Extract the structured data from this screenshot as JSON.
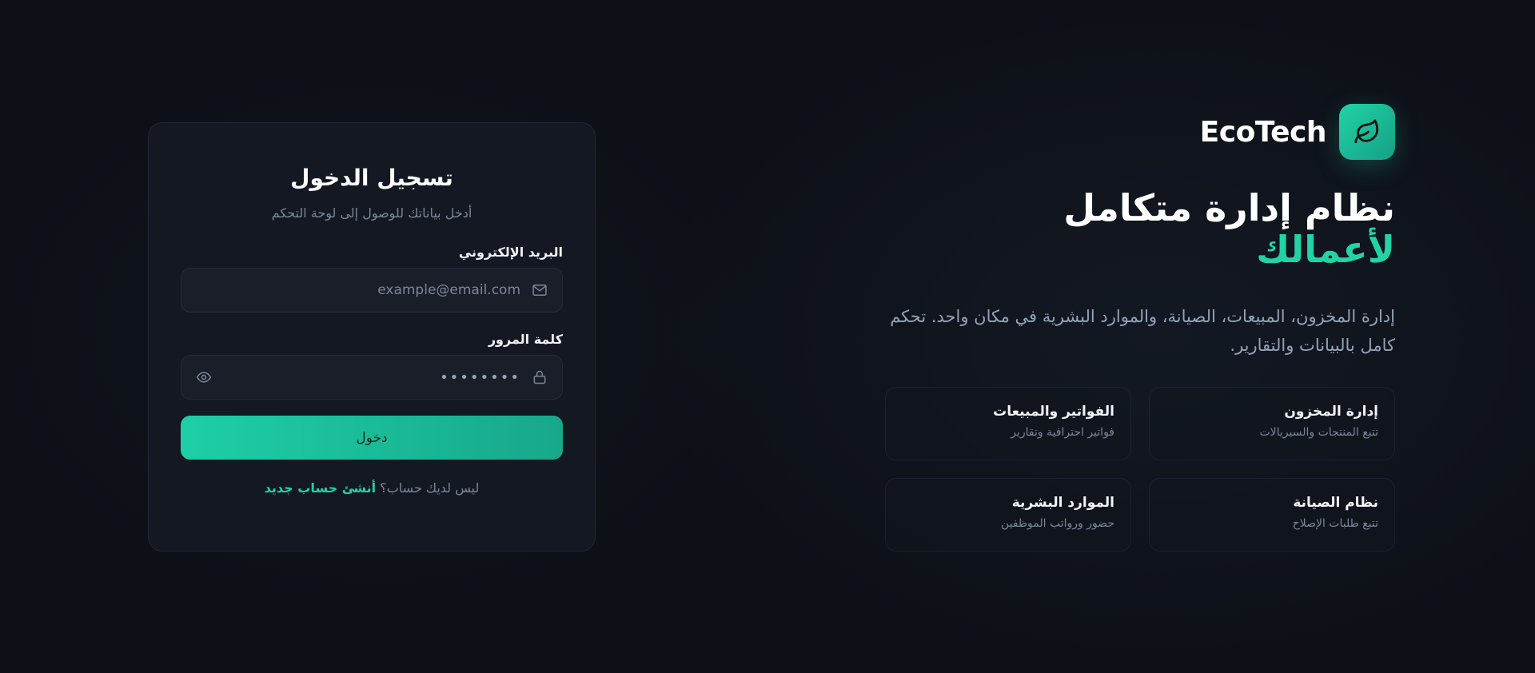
{
  "brand": {
    "name": "EcoTech",
    "logo_icon": "leaf-icon",
    "accent_color": "#22d3a6"
  },
  "hero": {
    "headline_line1": "نظام إدارة متكامل",
    "headline_line2": "لأعمالك",
    "description": "إدارة المخزون، المبيعات، الصيانة، والموارد البشرية في مكان واحد. تحكم كامل بالبيانات والتقارير.",
    "features": [
      {
        "title": "إدارة المخزون",
        "desc": "تتبع المنتجات والسيريالات"
      },
      {
        "title": "الفواتير والمبيعات",
        "desc": "فواتير احترافية وتقارير"
      },
      {
        "title": "نظام الصيانة",
        "desc": "تتبع طلبات الإصلاح"
      },
      {
        "title": "الموارد البشرية",
        "desc": "حضور ورواتب الموظفين"
      }
    ]
  },
  "login": {
    "title": "تسجيل الدخول",
    "subtitle": "أدخل بياناتك للوصول إلى لوحة التحكم",
    "email_label": "البريد الإلكتروني",
    "email_placeholder": "example@email.com",
    "email_icon": "mail-icon",
    "password_label": "كلمة المرور",
    "password_value": "••••••••",
    "password_icon": "lock-icon",
    "show_password_icon": "eye-icon",
    "submit_label": "دخول",
    "signup_prompt": "ليس لديك حساب؟",
    "signup_link": "أنشئ حساب جديد"
  }
}
